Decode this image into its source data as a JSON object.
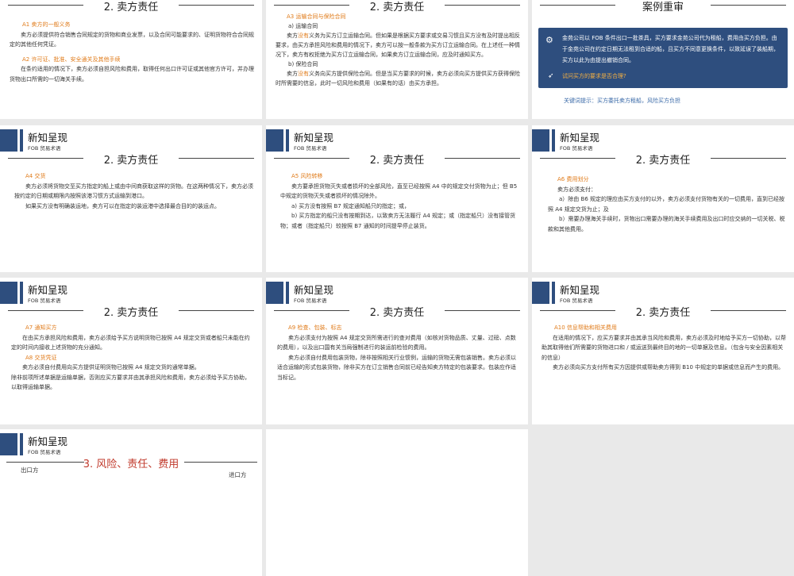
{
  "header": {
    "title": "新知呈现",
    "subtitle": "FOB 贸易术语"
  },
  "section": {
    "seller_duty": "2. 卖方责任",
    "case": "案例重审",
    "risk": "3. 风险、责任、费用"
  },
  "slides": {
    "s1": {
      "a1_title": "A1 卖方的一般义务",
      "a1_text": "卖方必须提供符合销售合同规定的货物和商业发票，以及合同可能要求的、证明货物符合合同规定的其他任何凭证。",
      "a2_title": "A2 许可证、批准、安全通关及其他手续",
      "a2_text": "在条约适用的情况下，卖方必须自担风险和费用，取得任何出口许可证或其他官方许可，并办理货物出口所需的一切海关手续。"
    },
    "s2": {
      "a3_title": "A3 运输合同与保险合同",
      "a_label": "a) 运输合同",
      "a_p1": "卖方",
      "a_hl": "没有",
      "a_p2": "义务为买方订立运输合同。但如果是根据买方要求或交易习惯且买方没有及时提出相反要求，由买方承担风险和费用的情况下，卖方可以按一般条款为买方订立运输合同。在上述任一种情况下，卖方有权拒绝为买方订立运输合同，如果卖方订立运输合同，应及时通知买方。",
      "b_label": "b) 保险合同",
      "b_p1": "卖方",
      "b_hl": "没有",
      "b_p2": "义务向买方提供保险合同。但是当买方要求的时候，卖方必须向买方提供买方获得保险时所需要的信息，此时一切风险和费用（如果有的话）由买方承担。"
    },
    "s3": {
      "case_text": "金苑公司以 FOB 条件出口一批茶具，买方要求金苑公司代为租船，费用由买方负担。由于金苑公司在约定日期无法租到合适的船，且买方不同意更换条件，以致延误了装船期，买方以此为由提出撤销合同。",
      "question": "试问买方的要求是否合理?",
      "hint": "关键词提示：买方委托卖方租船，风险买方负担"
    },
    "s4": {
      "a4_title": "A4  交货",
      "a4_text": "卖方必须将货物交至买方指定的船上或由中间商获取这样的货物。在这两种情况下，卖方必须按约定的日期或期限内按照该港习惯方式运输到港口。",
      "a4_text2": "如果买方没有明确装运地，卖方可以在指定的装运港中选择最合目的的装运点。"
    },
    "s5": {
      "a5_title": "A5 风险转移",
      "a5_text": "卖方要承担货物灭失或者损坏的全部风险，直至已经按照 A4 中的规定交付货物为止；但 B5 中规定的货物灭失或者损坏的情况除外。",
      "a5_a": "a) 买方没有按照 B7 规定通知船只的指定；或，",
      "a5_b": "b) 买方指定的船只没有按期到达，以致卖方无法履行 A4 规定；或（指定船只）没有接管货物；或者（指定船只）较按照 B7 通知的时间提早停止装货。"
    },
    "s6": {
      "a6_title": "A6  费用划分",
      "a6_lead": "卖方必须支付：",
      "a6_a": "a）除由 B6 规定的理应由买方支付的以外，卖方必须支付货物有关的一切费用，直到已经按照 A4 规定交货为止；及",
      "a6_b": "b）需要办理海关手续时，货物出口需要办理的海关手续费用及出口时应交纳的一切关税、税款和其他费用。"
    },
    "s7": {
      "a7_title": "A7 通知买方",
      "a7_text": "在由买方承担风险和费用，卖方必须给予买方说明货物已按照 A4 规定交货或者船只未能在约定的时间内接收上述货物的充分通知。",
      "a8_title": "A8 交货凭证",
      "a8_text": "卖方必须自付费用向买方提供证明货物已按照 A4 规定交货的通常单据。",
      "a8_text2": "除非前项所述单据是运输单据，否则应买方要求并由其承担风险和费用，卖方必须给予买方协助，以取得运输单据。"
    },
    "s8": {
      "a9_title": "A9  检查、包装、标志",
      "a9_text": "卖方必须支付为按照 A4 规定交货所需进行的查对费用（如核对货物品质、丈量、过磅、点数的费用），以及出口国有关当局强制进行的装运前检验的费用。",
      "a9_text2": "卖方必须自付费用包装货物，除非按照相关行业惯例，运输的货物无需包装销售。卖方必须以适合运输的形式包装货物，除非买方在订立销售合同前已经告知卖方特定的包装要求。包装应作适当标记。"
    },
    "s9": {
      "a10_title": "A10 信息帮助和相关费用",
      "a10_text": "在适用的情况下，应买方要求并由其承当风险和费用，卖方必须及时地给予买方一切协助，以帮助其取得他们所需要的货物进口和 / 或运送到最终目的地的一切单据及信息。（包含与安全因素相关的信息）",
      "a10_text2": "卖方必须向买方支付所有买方因提供或帮助卖方得到 B10 中规定的单据或信息而产生的费用。"
    },
    "s10": {
      "exporter": "出口方",
      "importer": "进口方"
    }
  },
  "colors": {
    "navy": "#2e4e7e",
    "orange": "#e07b1a",
    "red": "#c0392b"
  }
}
